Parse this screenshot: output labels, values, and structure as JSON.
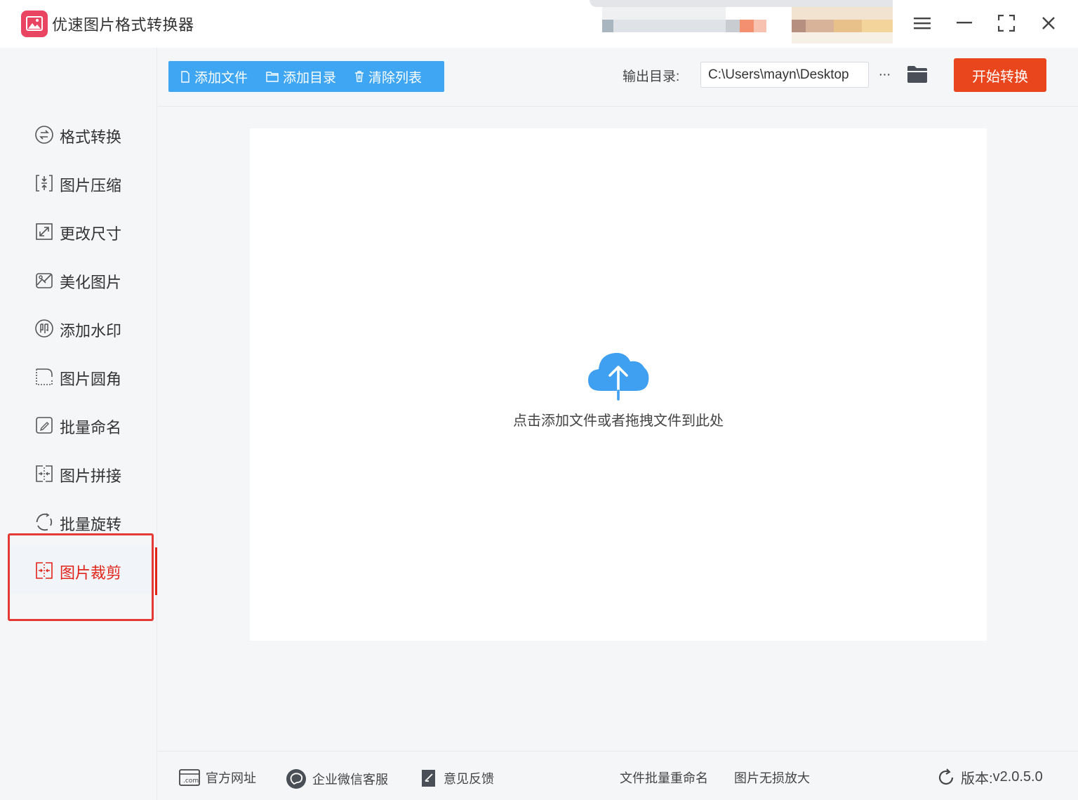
{
  "app": {
    "title": "优速图片格式转换器",
    "accent": "#3ea6f2",
    "danger": "#e9461d",
    "active_color": "#e2231a"
  },
  "sidebar": {
    "items": [
      {
        "label": "格式转换",
        "icon": "format-convert-icon",
        "active": false
      },
      {
        "label": "图片压缩",
        "icon": "compress-icon",
        "active": false
      },
      {
        "label": "更改尺寸",
        "icon": "resize-icon",
        "active": false
      },
      {
        "label": "美化图片",
        "icon": "beautify-icon",
        "active": false
      },
      {
        "label": "添加水印",
        "icon": "watermark-icon",
        "active": false
      },
      {
        "label": "图片圆角",
        "icon": "rounded-corner-icon",
        "active": false
      },
      {
        "label": "批量命名",
        "icon": "rename-icon",
        "active": false
      },
      {
        "label": "图片拼接",
        "icon": "stitch-icon",
        "active": false
      },
      {
        "label": "批量旋转",
        "icon": "rotate-icon",
        "active": false
      },
      {
        "label": "图片裁剪",
        "icon": "crop-icon",
        "active": true
      }
    ]
  },
  "toolbar": {
    "add_file": "添加文件",
    "add_folder": "添加目录",
    "clear_list": "清除列表",
    "output_label": "输出目录:",
    "output_path": "C:\\Users\\mayn\\Desktop",
    "more": "···",
    "start": "开始转换"
  },
  "droparea": {
    "hint": "点击添加文件或者拖拽文件到此处"
  },
  "footer": {
    "website": "官方网址",
    "wechat": "企业微信客服",
    "feedback": "意见反馈",
    "batch_rename": "文件批量重命名",
    "lossless_zoom": "图片无损放大",
    "version_label": "版本:",
    "version": "v2.0.5.0"
  }
}
